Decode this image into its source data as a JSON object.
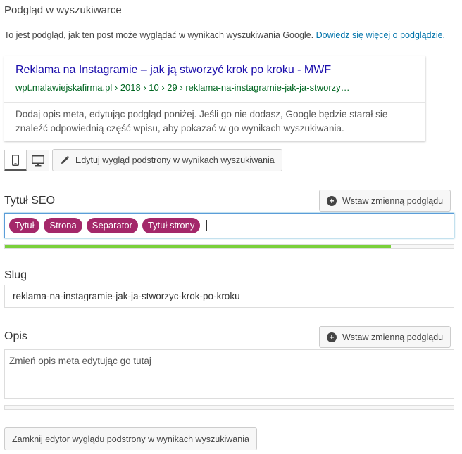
{
  "section": {
    "heading": "Podgląd w wyszukiwarce",
    "intro_text": "To jest podgląd, jak ten post może wyglądać w wynikach wyszukiwania Google. ",
    "intro_link": "Dowiedz się więcej o podglądzie."
  },
  "snippet": {
    "title": "Reklama na Instagramie – jak ją stworzyć krok po kroku - MWF",
    "url": "wpt.malawiejskafirma.pl › 2018 › 10 › 29 › reklama-na-instagramie-jak-ja-stworzy…",
    "description": "Dodaj opis meta, edytując podgląd poniżej. Jeśli go nie dodasz, Google będzie starał się znaleźć odpowiednią część wpisu, aby pokazać w go wynikach wyszukiwania."
  },
  "toolbar": {
    "edit_label": "Edytuj wygląd podstrony w wynikach wyszukiwania"
  },
  "seo_title": {
    "label": "Tytuł SEO",
    "insert_label": "Wstaw zmienną podglądu",
    "pills": [
      "Tytuł",
      "Strona",
      "Separator",
      "Tytuł strony"
    ],
    "progress": 0.86
  },
  "slug": {
    "label": "Slug",
    "value": "reklama-na-instagramie-jak-ja-stworzyc-krok-po-kroku"
  },
  "description": {
    "label": "Opis",
    "insert_label": "Wstaw zmienną podglądu",
    "placeholder": "Zmień opis meta edytując go tutaj",
    "progress": 0
  },
  "footer": {
    "close_label": "Zamknij edytor wyglądu podstrony w wynikach wyszukiwania"
  },
  "colors": {
    "pill": "#a4286a",
    "progress_ok": "#7ad03a",
    "link": "#0073aa",
    "snippet_title": "#1a0dab",
    "snippet_url": "#006621"
  }
}
